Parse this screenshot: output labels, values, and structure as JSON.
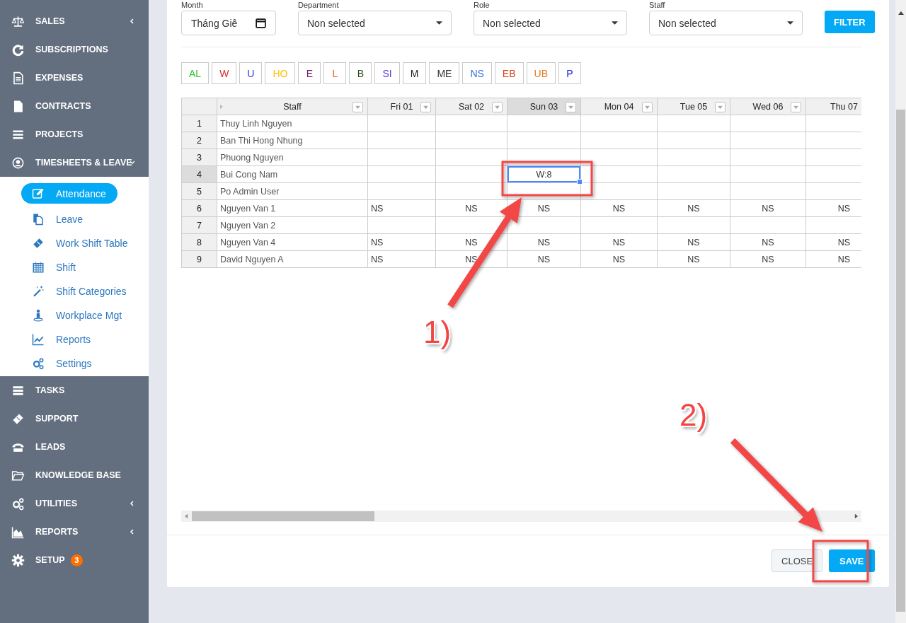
{
  "sidebar": {
    "items": [
      {
        "label": "SALES",
        "kind": "menu",
        "expanded": false
      },
      {
        "label": "SUBSCRIPTIONS",
        "kind": "link"
      },
      {
        "label": "EXPENSES",
        "kind": "link"
      },
      {
        "label": "CONTRACTS",
        "kind": "link"
      },
      {
        "label": "PROJECTS",
        "kind": "link"
      },
      {
        "label": "TIMESHEETS & LEAVE",
        "kind": "menu",
        "expanded": true,
        "children": [
          {
            "label": "Attendance",
            "selected": true
          },
          {
            "label": "Leave",
            "selected": false
          },
          {
            "label": "Work Shift Table",
            "selected": false
          },
          {
            "label": "Shift",
            "selected": false
          },
          {
            "label": "Shift Categories",
            "selected": false
          },
          {
            "label": "Workplace Mgt",
            "selected": false
          },
          {
            "label": "Reports",
            "selected": false
          },
          {
            "label": "Settings",
            "selected": false
          }
        ]
      },
      {
        "label": "TASKS",
        "kind": "link"
      },
      {
        "label": "SUPPORT",
        "kind": "link"
      },
      {
        "label": "LEADS",
        "kind": "link"
      },
      {
        "label": "KNOWLEDGE BASE",
        "kind": "link"
      },
      {
        "label": "UTILITIES",
        "kind": "menu",
        "expanded": false
      },
      {
        "label": "REPORTS",
        "kind": "menu",
        "expanded": false
      },
      {
        "label": "SETUP",
        "kind": "link",
        "badge": "3"
      }
    ]
  },
  "filters": [
    {
      "label": "Month",
      "kind": "date",
      "value": "Tháng Giê"
    },
    {
      "label": "Department",
      "kind": "select",
      "value": "Non selected"
    },
    {
      "label": "Role",
      "kind": "select",
      "value": "Non selected"
    },
    {
      "label": "Staff",
      "kind": "select",
      "value": "Non selected"
    }
  ],
  "filter_button": "FILTER",
  "legend": [
    {
      "code": "AL",
      "color": "#2ec52e"
    },
    {
      "code": "W",
      "color": "#d32f2f"
    },
    {
      "code": "U",
      "color": "#2a3ad6"
    },
    {
      "code": "HO",
      "color": "#ffc107"
    },
    {
      "code": "E",
      "color": "#6a1b6a"
    },
    {
      "code": "L",
      "color": "#ff5722"
    },
    {
      "code": "B",
      "color": "#2e4d1e"
    },
    {
      "code": "SI",
      "color": "#5a3ad6"
    },
    {
      "code": "M",
      "color": "#222222"
    },
    {
      "code": "ME",
      "color": "#333333"
    },
    {
      "code": "NS",
      "color": "#2f6fdb"
    },
    {
      "code": "EB",
      "color": "#d84315"
    },
    {
      "code": "UB",
      "color": "#e07b20"
    },
    {
      "code": "P",
      "color": "#2020d0"
    }
  ],
  "table": {
    "columns": [
      {
        "label": "Staff",
        "selected": false,
        "filter_button": true
      },
      {
        "label": "Fri 01",
        "selected": false,
        "filter_button": true
      },
      {
        "label": "Sat 02",
        "selected": false,
        "filter_button": true
      },
      {
        "label": "Sun 03",
        "selected": true,
        "filter_button": true
      },
      {
        "label": "Mon 04",
        "selected": false,
        "filter_button": true
      },
      {
        "label": "Tue 05",
        "selected": false,
        "filter_button": true
      },
      {
        "label": "Wed 06",
        "selected": false,
        "filter_button": true
      },
      {
        "label": "Thu 07",
        "selected": false,
        "filter_button": false
      }
    ],
    "rows": [
      {
        "number": "1",
        "selected": false,
        "cells": [
          "Thuy Linh Nguyen",
          null,
          null,
          null,
          null,
          null,
          null,
          null
        ]
      },
      {
        "number": "2",
        "selected": false,
        "cells": [
          "Ban Thi Hong Nhung",
          null,
          null,
          null,
          null,
          null,
          null,
          null
        ]
      },
      {
        "number": "3",
        "selected": false,
        "cells": [
          "Phuong Nguyen",
          null,
          null,
          null,
          null,
          null,
          null,
          null
        ]
      },
      {
        "number": "4",
        "selected": true,
        "cells": [
          "Bui Cong Nam",
          null,
          null,
          "W:8",
          null,
          null,
          null,
          null
        ]
      },
      {
        "number": "5",
        "selected": false,
        "cells": [
          "Po Admin User",
          null,
          null,
          null,
          null,
          null,
          null,
          null
        ]
      },
      {
        "number": "6",
        "selected": false,
        "cells": [
          "Nguyen Van 1",
          "NS",
          "NS",
          "NS",
          "NS",
          "NS",
          "NS",
          "NS"
        ]
      },
      {
        "number": "7",
        "selected": false,
        "cells": [
          "Nguyen Van 2",
          null,
          null,
          null,
          null,
          null,
          null,
          null
        ]
      },
      {
        "number": "8",
        "selected": false,
        "cells": [
          "Nguyen Van 4",
          "NS",
          "NS",
          "NS",
          "NS",
          "NS",
          "NS",
          "NS"
        ]
      },
      {
        "number": "9",
        "selected": false,
        "cells": [
          "David Nguyen A",
          "NS",
          "NS",
          "NS",
          "NS",
          "NS",
          "NS",
          "NS"
        ]
      }
    ]
  },
  "footer": {
    "buttons": [
      {
        "label": "CLOSE",
        "kind": "secondary"
      },
      {
        "label": "SAVE",
        "kind": "primary"
      }
    ]
  },
  "annotations": [
    {
      "label": "1)"
    },
    {
      "label": "2)"
    }
  ]
}
